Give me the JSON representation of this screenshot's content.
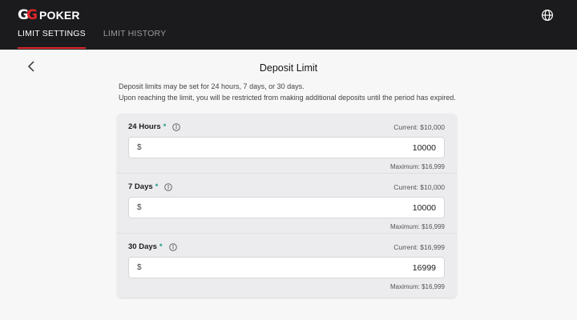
{
  "header": {
    "logo_text": "POKER",
    "logo_mark": "GG",
    "globe_icon": "globe-icon",
    "tabs": [
      {
        "label": "LIMIT SETTINGS",
        "active": true
      },
      {
        "label": "LIMIT HISTORY",
        "active": false
      }
    ],
    "accent_color": "#e3262b"
  },
  "page": {
    "title": "Deposit Limit",
    "description_line1": "Deposit limits may be set for 24 hours, 7 days, or 30 days.",
    "description_line2": "Upon reaching the limit, you will be restricted from making additional deposits until the period has expired."
  },
  "limits": [
    {
      "label": "24 Hours",
      "required_mark": "*",
      "current": "Current: $10,000",
      "currency": "$",
      "value": "10000",
      "maximum": "Maximum: $16,999"
    },
    {
      "label": "7 Days",
      "required_mark": "*",
      "current": "Current: $10,000",
      "currency": "$",
      "value": "10000",
      "maximum": "Maximum: $16,999"
    },
    {
      "label": "30 Days",
      "required_mark": "*",
      "current": "Current: $16,999",
      "currency": "$",
      "value": "16999",
      "maximum": "Maximum: $16,999"
    }
  ]
}
